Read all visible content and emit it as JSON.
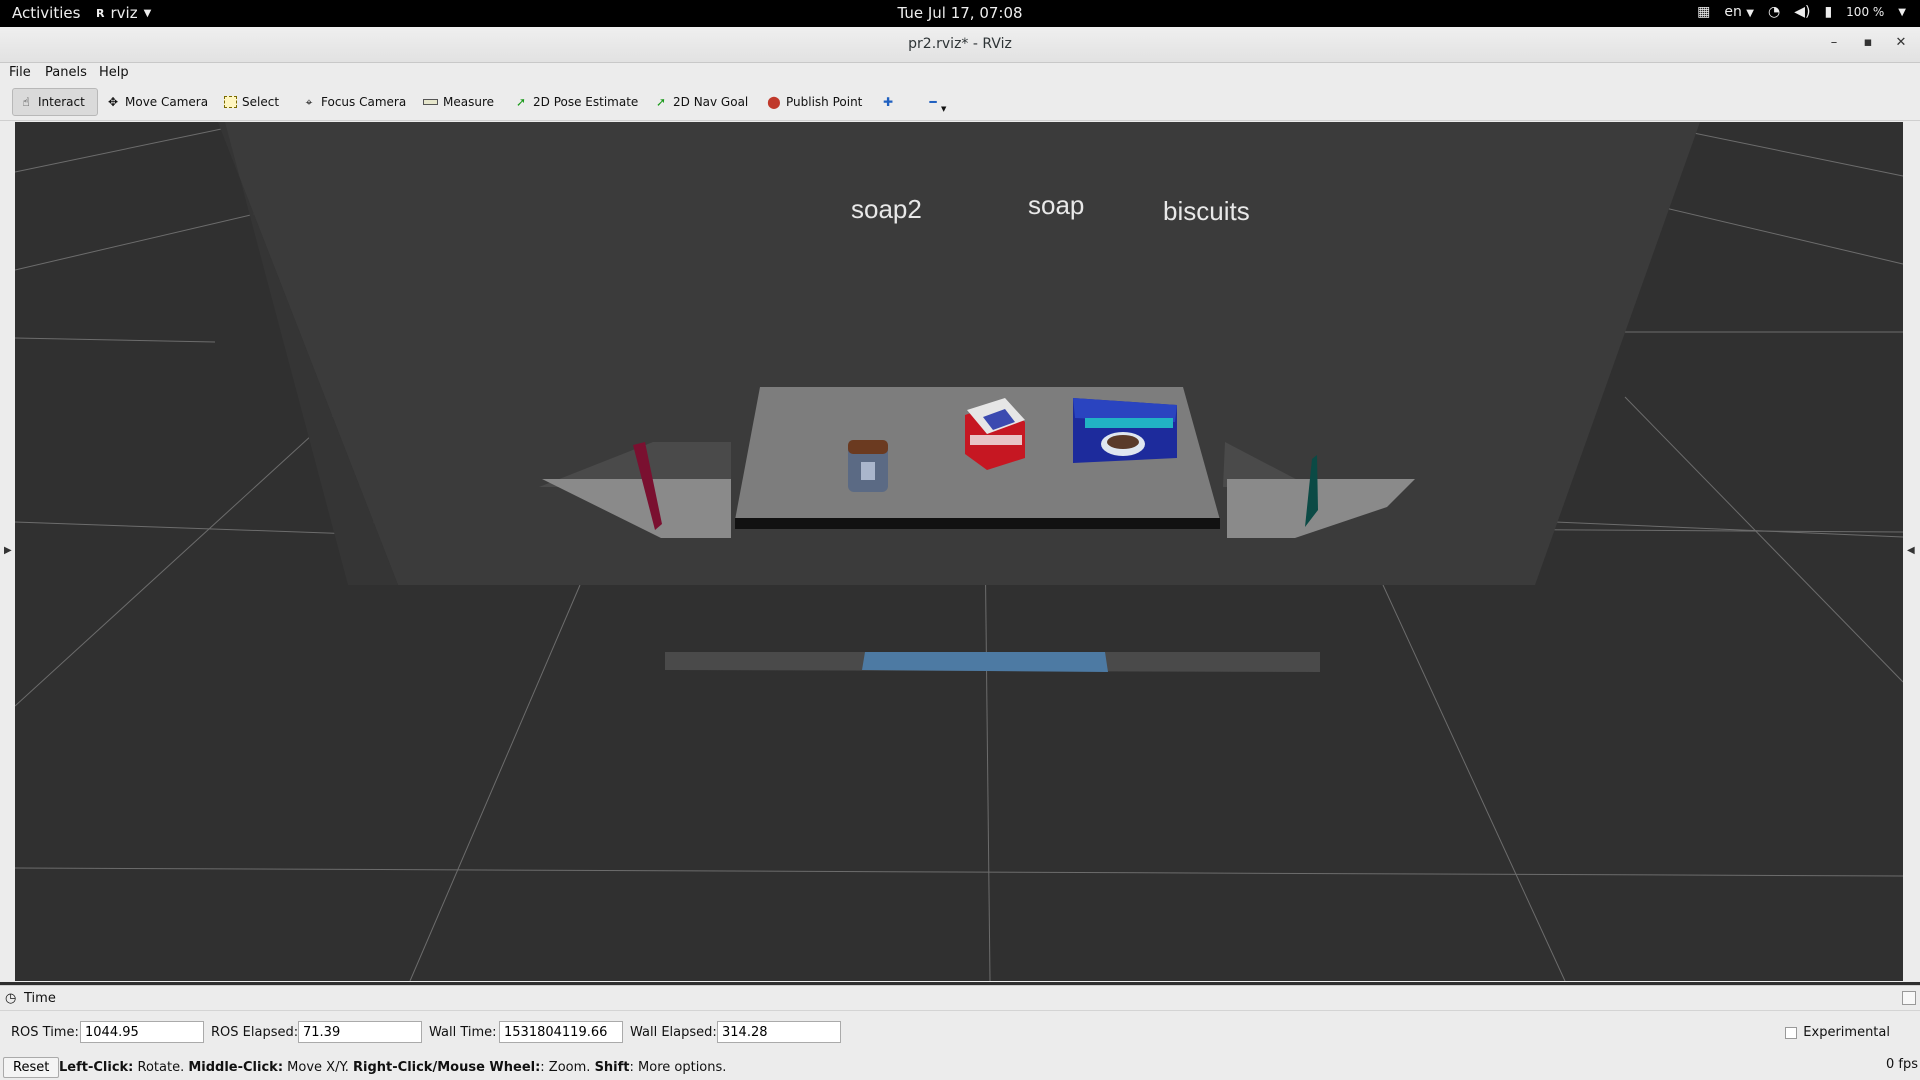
{
  "topbar": {
    "activities": "Activities",
    "app_name": "rviz",
    "clock": "Tue Jul 17, 07:08",
    "lang": "en",
    "battery": "100 %"
  },
  "window": {
    "title": "pr2.rviz* - RViz"
  },
  "menu": {
    "file": "File",
    "panels": "Panels",
    "help": "Help"
  },
  "toolbar": {
    "interact": "Interact",
    "move_camera": "Move Camera",
    "select": "Select",
    "focus_camera": "Focus Camera",
    "measure": "Measure",
    "pose_estimate": "2D Pose Estimate",
    "nav_goal": "2D Nav Goal",
    "publish_point": "Publish Point"
  },
  "scene": {
    "labels": {
      "soap2": "soap2",
      "soap": "soap",
      "biscuits": "biscuits"
    },
    "colors": {
      "background": "#303030",
      "grid": "#8a8a8a",
      "table": "#7a7a7a",
      "wall": "#3b3b3b"
    }
  },
  "time_panel": {
    "title": "Time",
    "ros_time_label": "ROS Time:",
    "ros_time": "1044.95",
    "ros_elapsed_label": "ROS Elapsed:",
    "ros_elapsed": "71.39",
    "wall_time_label": "Wall Time:",
    "wall_time": "1531804119.66",
    "wall_elapsed_label": "Wall Elapsed:",
    "wall_elapsed": "314.28",
    "experimental": "Experimental"
  },
  "status": {
    "reset": "Reset",
    "h1": "Left-Click:",
    "t1": " Rotate. ",
    "h2": "Middle-Click:",
    "t2": " Move X/Y. ",
    "h3": "Right-Click/Mouse Wheel:",
    "t3": ": Zoom. ",
    "h4": "Shift",
    "t4": ": More options.",
    "fps": "0 fps"
  }
}
